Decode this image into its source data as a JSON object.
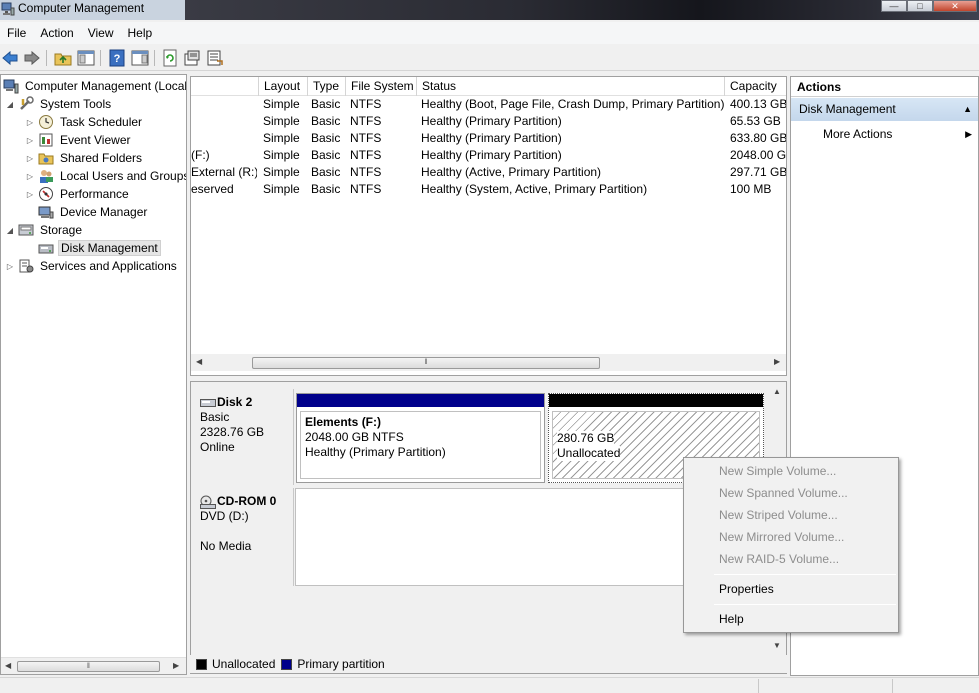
{
  "window": {
    "title": "Computer Management"
  },
  "menu": [
    "File",
    "Action",
    "View",
    "Help"
  ],
  "toolbar_icons": [
    "back-arrow-icon",
    "forward-arrow-icon",
    "up-folder-icon",
    "show-hide-tree-icon",
    "help-icon",
    "show-hide-action-pane-icon",
    "refresh-icon",
    "properties-icon",
    "export-list-icon"
  ],
  "tree": {
    "root": "Computer Management (Local",
    "items": [
      {
        "label": "System Tools",
        "level": 1,
        "expanded": true
      },
      {
        "label": "Task Scheduler",
        "level": 2
      },
      {
        "label": "Event Viewer",
        "level": 2
      },
      {
        "label": "Shared Folders",
        "level": 2
      },
      {
        "label": "Local Users and Groups",
        "level": 2
      },
      {
        "label": "Performance",
        "level": 2
      },
      {
        "label": "Device Manager",
        "level": 2
      },
      {
        "label": "Storage",
        "level": 1,
        "expanded": true
      },
      {
        "label": "Disk Management",
        "level": 2,
        "selected": true
      },
      {
        "label": "Services and Applications",
        "level": 1
      }
    ]
  },
  "volume_list": {
    "columns": [
      "Layout",
      "Type",
      "File System",
      "Status",
      "Capacity"
    ],
    "rows": [
      {
        "volume": "",
        "layout": "Simple",
        "type": "Basic",
        "fs": "NTFS",
        "status": "Healthy (Boot, Page File, Crash Dump, Primary Partition)",
        "capacity": "400.13 GB"
      },
      {
        "volume": "",
        "layout": "Simple",
        "type": "Basic",
        "fs": "NTFS",
        "status": "Healthy (Primary Partition)",
        "capacity": "65.53 GB"
      },
      {
        "volume": "",
        "layout": "Simple",
        "type": "Basic",
        "fs": "NTFS",
        "status": "Healthy (Primary Partition)",
        "capacity": "633.80 GB"
      },
      {
        "volume": "(F:)",
        "layout": "Simple",
        "type": "Basic",
        "fs": "NTFS",
        "status": "Healthy (Primary Partition)",
        "capacity": "2048.00 GE"
      },
      {
        "volume": "External (R:)",
        "layout": "Simple",
        "type": "Basic",
        "fs": "NTFS",
        "status": "Healthy (Active, Primary Partition)",
        "capacity": "297.71 GB"
      },
      {
        "volume": "eserved",
        "layout": "Simple",
        "type": "Basic",
        "fs": "NTFS",
        "status": "Healthy (System, Active, Primary Partition)",
        "capacity": "100 MB"
      }
    ]
  },
  "disks": [
    {
      "name": "Disk 2",
      "kind": "Basic",
      "size": "2328.76 GB",
      "state": "Online",
      "partitions": [
        {
          "title": "Elements  (F:)",
          "line1": "2048.00 GB NTFS",
          "line2": "Healthy (Primary Partition)",
          "bar_color": "#00008b"
        },
        {
          "title": "",
          "line1": "280.76 GB",
          "line2": "Unallocated",
          "bar_color": "#000000"
        }
      ]
    },
    {
      "name": "CD-ROM 0",
      "kind": "DVD (D:)",
      "size": "",
      "state": "No Media"
    }
  ],
  "legend": [
    {
      "label": "Unallocated",
      "color": "#000000"
    },
    {
      "label": "Primary partition",
      "color": "#00008b"
    }
  ],
  "actions": {
    "header": "Actions",
    "section": "Disk Management",
    "items": [
      "More Actions"
    ]
  },
  "context_menu": {
    "items": [
      {
        "label": "New Simple Volume...",
        "enabled": false
      },
      {
        "label": "New Spanned Volume...",
        "enabled": false
      },
      {
        "label": "New Striped Volume...",
        "enabled": false
      },
      {
        "label": "New Mirrored Volume...",
        "enabled": false
      },
      {
        "label": "New RAID-5 Volume...",
        "enabled": false
      },
      {
        "label": "Properties",
        "enabled": true
      },
      {
        "label": "Help",
        "enabled": true
      }
    ]
  }
}
